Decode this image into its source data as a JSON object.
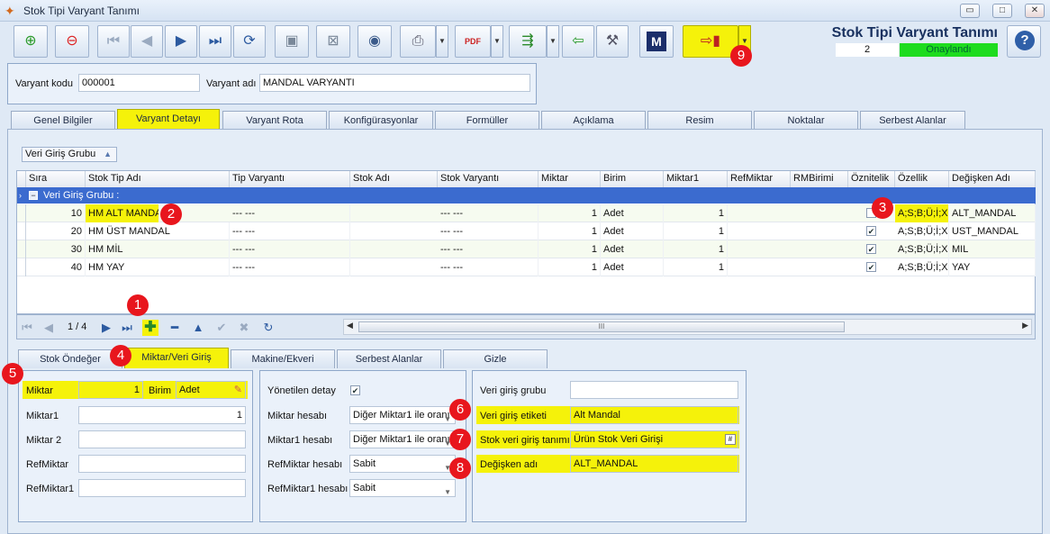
{
  "window": {
    "title": "Stok Tipi Varyant Tanımı",
    "min": "▭",
    "max": "□",
    "close": "✕"
  },
  "header": {
    "doc_title": "Stok Tipi Varyant Tanımı",
    "doc_number": "2",
    "status": "Onaylandı",
    "help": "?"
  },
  "toolbar": {
    "icons": [
      "new-icon",
      "delete-icon",
      "first-icon",
      "prev-icon",
      "next-icon",
      "last-icon",
      "refresh-icon",
      "save-icon",
      "cancel-save-icon",
      "preview-icon",
      "print-icon",
      "pdf-icon",
      "export-icon",
      "back-icon",
      "tools-icon",
      "m-icon",
      "exit-icon"
    ],
    "m_label": "M",
    "pdf_label": "PDF"
  },
  "form": {
    "code_label": "Varyant kodu",
    "code_value": "000001",
    "name_label": "Varyant adı",
    "name_value": "MANDAL VARYANTI"
  },
  "tabs": [
    "Genel Bilgiler",
    "Varyant Detayı",
    "Varyant Rota",
    "Konfigürasyonlar",
    "Formüller",
    "Açıklama",
    "Resim",
    "Noktalar",
    "Serbest Alanlar"
  ],
  "group_box": "Veri Giriş Grubu",
  "grid": {
    "columns": [
      "Sıra",
      "Stok Tip Adı",
      "Tip Varyantı",
      "Stok Adı",
      "Stok Varyantı",
      "Miktar",
      "Birim",
      "Miktar1",
      "RefMiktar",
      "RMBirimi",
      "Öznitelik",
      "Özellik",
      "Değişken Adı"
    ],
    "group_label": "Veri Giriş Grubu :",
    "rows": [
      {
        "sira": "10",
        "stok_tip": "HM ALT MANDAL",
        "tip_var": "--- ---",
        "stok_var": "--- ---",
        "miktar": "1",
        "birim": "Adet",
        "miktar1": "1",
        "ozellik": "A;S;B;Ü;İ;X",
        "degisken": "ALT_MANDAL"
      },
      {
        "sira": "20",
        "stok_tip": "HM ÜST MANDAL",
        "tip_var": "--- ---",
        "stok_var": "--- ---",
        "miktar": "1",
        "birim": "Adet",
        "miktar1": "1",
        "ozellik": "A;S;B;Ü;İ;X",
        "degisken": "UST_MANDAL"
      },
      {
        "sira": "30",
        "stok_tip": "HM MİL",
        "tip_var": "--- ---",
        "stok_var": "--- ---",
        "miktar": "1",
        "birim": "Adet",
        "miktar1": "1",
        "ozellik": "A;S;B;Ü;İ;X",
        "degisken": "MIL"
      },
      {
        "sira": "40",
        "stok_tip": "HM YAY",
        "tip_var": "--- ---",
        "stok_var": "--- ---",
        "miktar": "1",
        "birim": "Adet",
        "miktar1": "1",
        "ozellik": "A;S;B;Ü;İ;X",
        "degisken": "YAY"
      }
    ],
    "nav_record": "1 / 4",
    "scroll_grip": "III"
  },
  "subtabs": [
    "Stok Öndeğer",
    "Miktar/Veri Giriş",
    "Makine/Ekveri",
    "Serbest Alanlar",
    "Gizle"
  ],
  "left_panel": {
    "miktar_label": "Miktar",
    "miktar_value": "1",
    "birim_label": "Birim",
    "birim_value": "Adet",
    "miktar1_label": "Miktar1",
    "miktar1_value": "1",
    "miktar2_label": "Miktar 2",
    "refmiktar_label": "RefMiktar",
    "refmiktar1_label": "RefMiktar1"
  },
  "mid_panel": {
    "yonetilen_label": "Yönetilen detay",
    "miktar_hesabi_label": "Miktar hesabı",
    "miktar_hesabi_value": "Diğer Miktar1 ile oranı",
    "miktar1_hesabi_label": "Miktar1 hesabı",
    "miktar1_hesabi_value": "Diğer Miktar1 ile oranı",
    "ref_hesabi_label": "RefMiktar hesabı",
    "ref_hesabi_value": "Sabit",
    "ref1_hesabi_label": "RefMiktar1 hesabı",
    "ref1_hesabi_value": "Sabit"
  },
  "right_panel": {
    "grup_label": "Veri giriş grubu",
    "etiket_label": "Veri giriş etiketi",
    "etiket_value": "Alt Mandal",
    "tanim_label": "Stok veri giriş tanımı",
    "tanim_value": "Ürün Stok Veri Girişi",
    "tanim_btn": "#",
    "degisken_label": "Değişken adı",
    "degisken_value": "ALT_MANDAL"
  },
  "badges": [
    "1",
    "2",
    "3",
    "4",
    "5",
    "6",
    "7",
    "8",
    "9"
  ],
  "colors": {
    "highlight": "#f5f20a",
    "badge": "#e8161d",
    "status": "#1edc1e",
    "group_row": "#3b6bcf"
  }
}
